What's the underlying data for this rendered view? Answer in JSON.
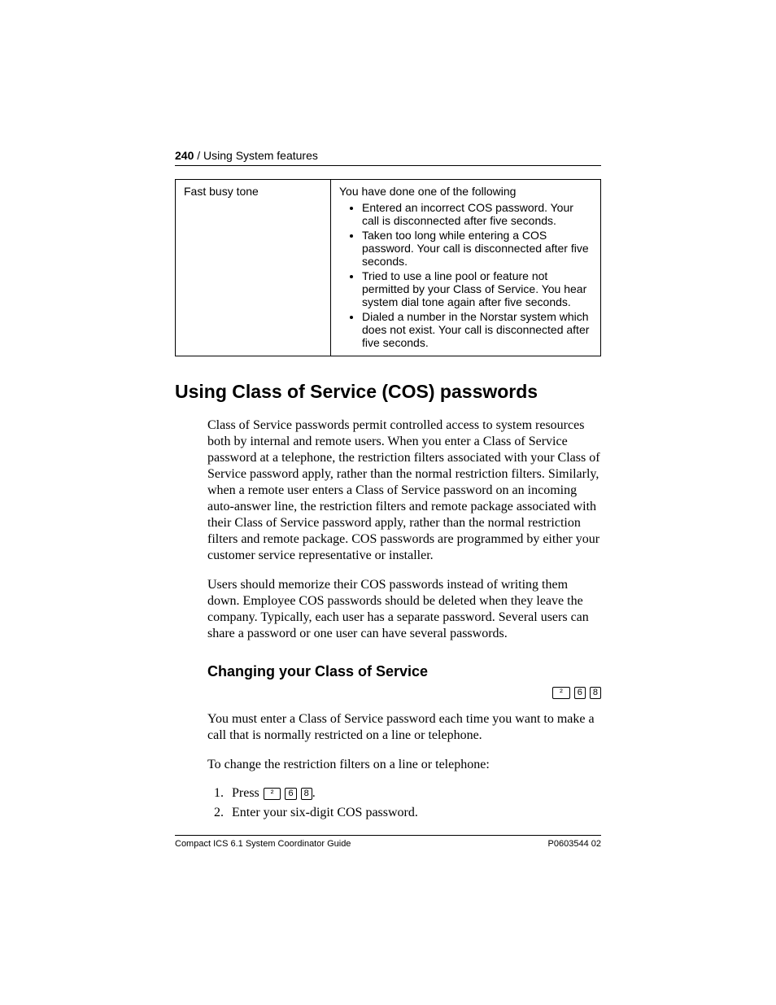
{
  "header": {
    "page_number": "240",
    "separator": " / ",
    "section": "Using System features"
  },
  "table": {
    "left": "Fast busy tone",
    "right_intro": "You have done one of the following",
    "bullets": [
      "Entered an incorrect COS password. Your call is disconnected after five seconds.",
      "Taken too long while entering a COS password. Your call is disconnected after five seconds.",
      "Tried to use a line pool or feature not permitted by your Class of Service. You hear system dial tone again after five seconds.",
      "Dialed a number in the Norstar system which does not exist. Your call is disconnected after five seconds."
    ]
  },
  "h1": "Using Class of Service (COS) passwords",
  "para1": "Class of Service passwords permit controlled access to system resources both by internal and remote users. When you enter a Class of Service password at a telephone, the restriction filters associated with your Class of Service password apply, rather than the normal restriction filters. Similarly, when a remote user enters a Class of Service password on an incoming auto-answer line, the restriction filters and remote package associated with their Class of Service password apply, rather than the normal restriction filters and remote package. COS passwords are programmed by either your customer service representative or installer.",
  "para2": "Users should memorize their COS passwords instead of writing them down. Employee COS passwords should be deleted when they leave the company. Typically, each user has a separate password. Several users can share a password or one user can have several passwords.",
  "h2": "Changing your Class of Service",
  "keys": {
    "feature": "²",
    "d1": "6",
    "d2": "8"
  },
  "para3": "You must enter a Class of Service password each time you want to make a call that is normally restricted on a line or telephone.",
  "para4": "To change the restriction filters on a line or telephone:",
  "steps": {
    "s1a": "Press ",
    "s1b": ".",
    "s2": "Enter your six-digit COS password."
  },
  "footer": {
    "left": "Compact ICS 6.1 System Coordinator Guide",
    "right": "P0603544  02"
  }
}
